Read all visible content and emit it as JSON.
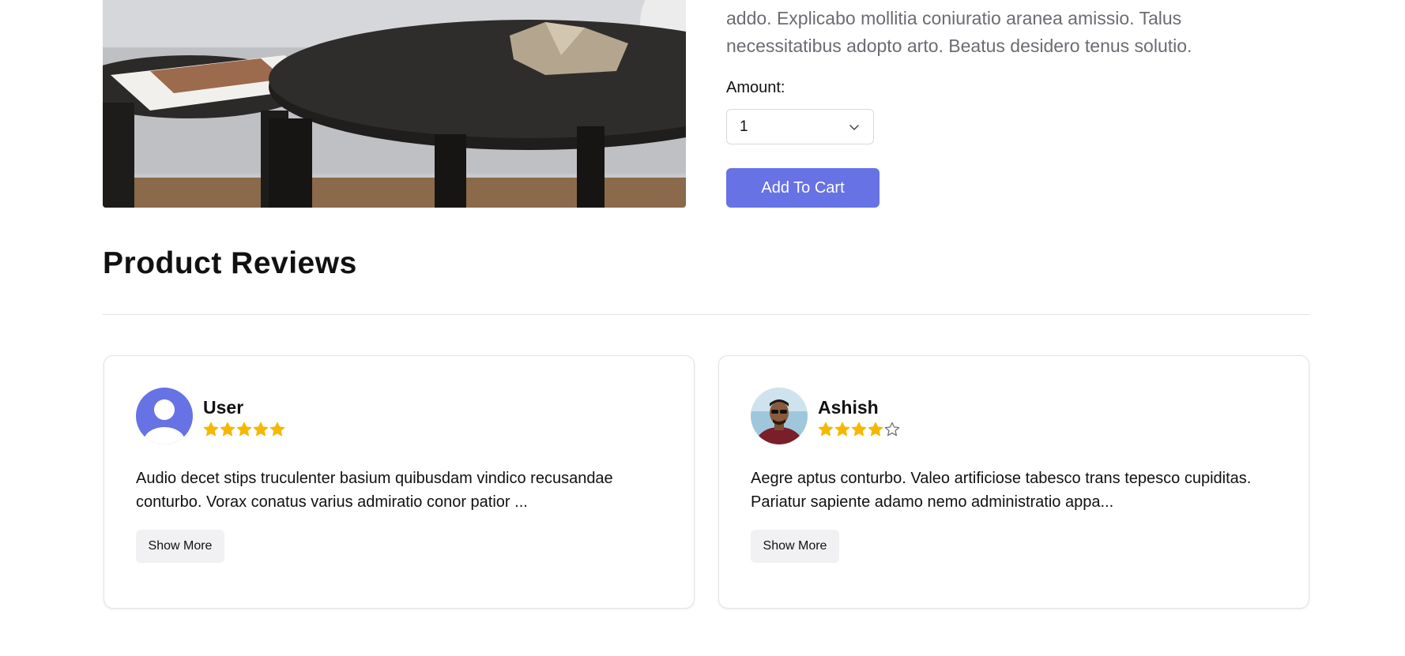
{
  "product": {
    "description": "addo. Explicabo mollitia coniuratio aranea amissio. Talus necessitatibus adopto arto. Beatus desidero tenus solutio.",
    "amount_label": "Amount:",
    "amount_value": "1",
    "add_to_cart_label": "Add To Cart"
  },
  "reviews": {
    "title": "Product Reviews",
    "items": [
      {
        "name": "User",
        "rating": 5,
        "text": "Audio decet stips truculenter basium quibusdam vindico recusandae conturbo. Vorax conatus varius admiratio conor patior ...",
        "show_more_label": "Show More",
        "avatar": "default-user-icon"
      },
      {
        "name": "Ashish",
        "rating": 4,
        "text": "Aegre aptus conturbo. Valeo artificiose tabesco trans tepesco cupiditas. Pariatur sapiente adamo nemo administratio appa...",
        "show_more_label": "Show More",
        "avatar": "user-photo"
      }
    ]
  },
  "colors": {
    "accent": "#6772e5",
    "star_filled": "#f5b800",
    "star_empty": "#6b7280"
  }
}
